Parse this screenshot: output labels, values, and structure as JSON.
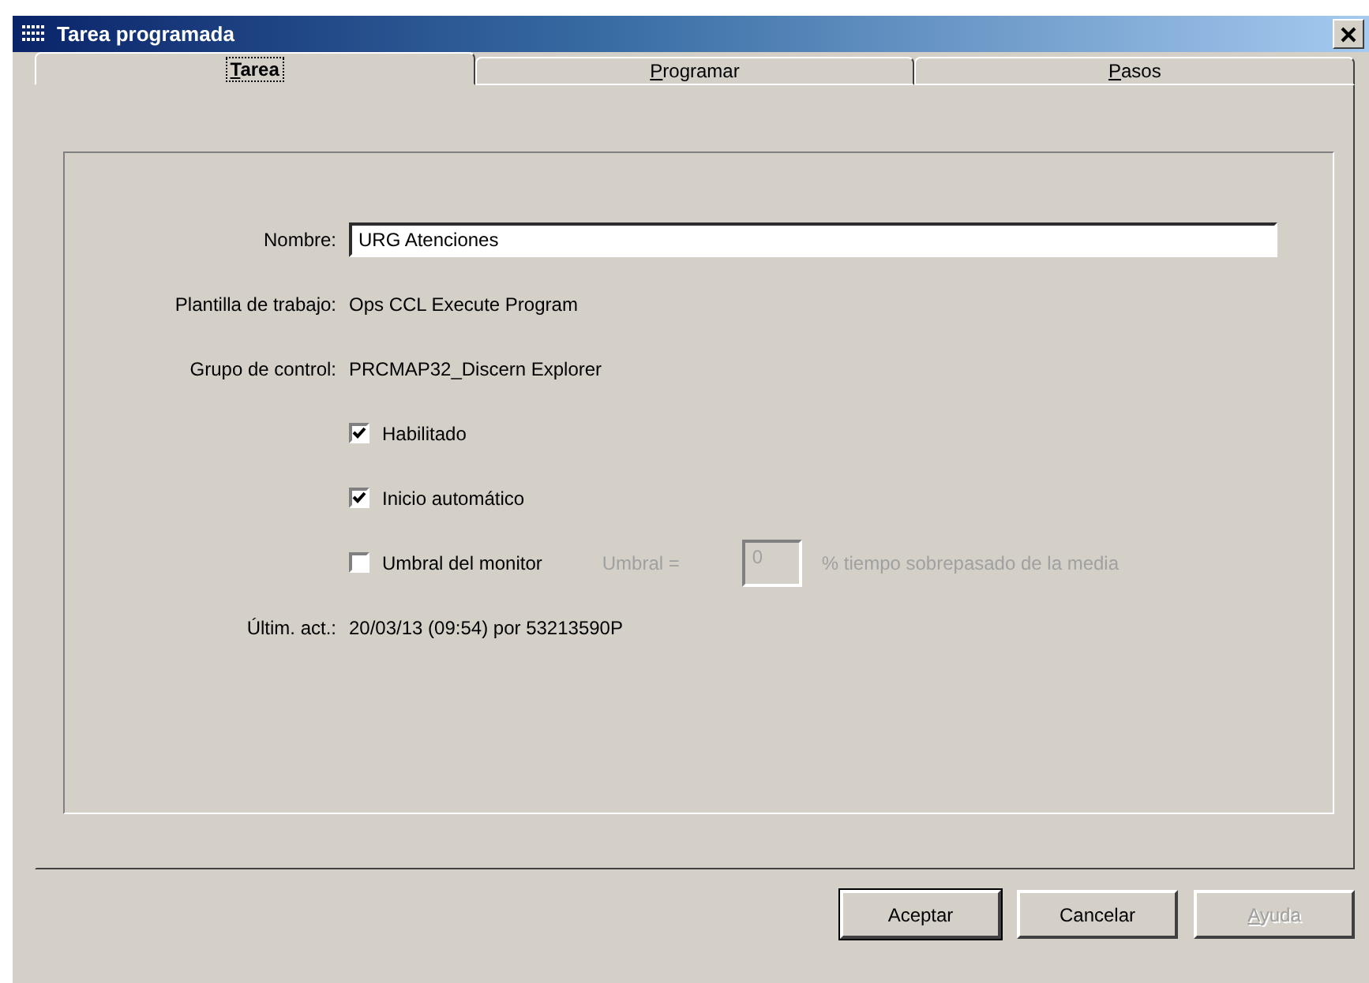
{
  "window": {
    "title": "Tarea programada"
  },
  "tabs": [
    {
      "label": "Tarea",
      "selected": true
    },
    {
      "label": "Programar",
      "selected": false
    },
    {
      "label": "Pasos",
      "selected": false
    }
  ],
  "rows": [
    {
      "kind": "input",
      "label": "Nombre:",
      "value": "URG Atenciones"
    },
    {
      "kind": "text",
      "label": "Plantilla de trabajo:",
      "value": "Ops CCL Execute Program"
    },
    {
      "kind": "text",
      "label": "Grupo de control:",
      "value": "PRCMAP32_Discern Explorer"
    },
    {
      "kind": "checkbox",
      "label": "Habilitado",
      "checked": true
    },
    {
      "kind": "checkbox",
      "label": "Inicio automático",
      "checked": true
    },
    {
      "kind": "checkbox",
      "label": "Umbral del monitor",
      "checked": false,
      "threshold": {
        "label": "Umbral =",
        "value": "0",
        "suffix": "% tiempo sobrepasado de la media",
        "disabled": true
      }
    },
    {
      "kind": "text",
      "label": "Últim. act.:",
      "value": "20/03/13 (09:54) por 53213590P"
    }
  ],
  "buttons": [
    {
      "label": "Aceptar",
      "default": true,
      "disabled": false,
      "access_key": false
    },
    {
      "label": "Cancelar",
      "default": false,
      "disabled": false,
      "access_key": false
    },
    {
      "label": "Ayuda",
      "default": false,
      "disabled": true,
      "access_key": true
    }
  ]
}
